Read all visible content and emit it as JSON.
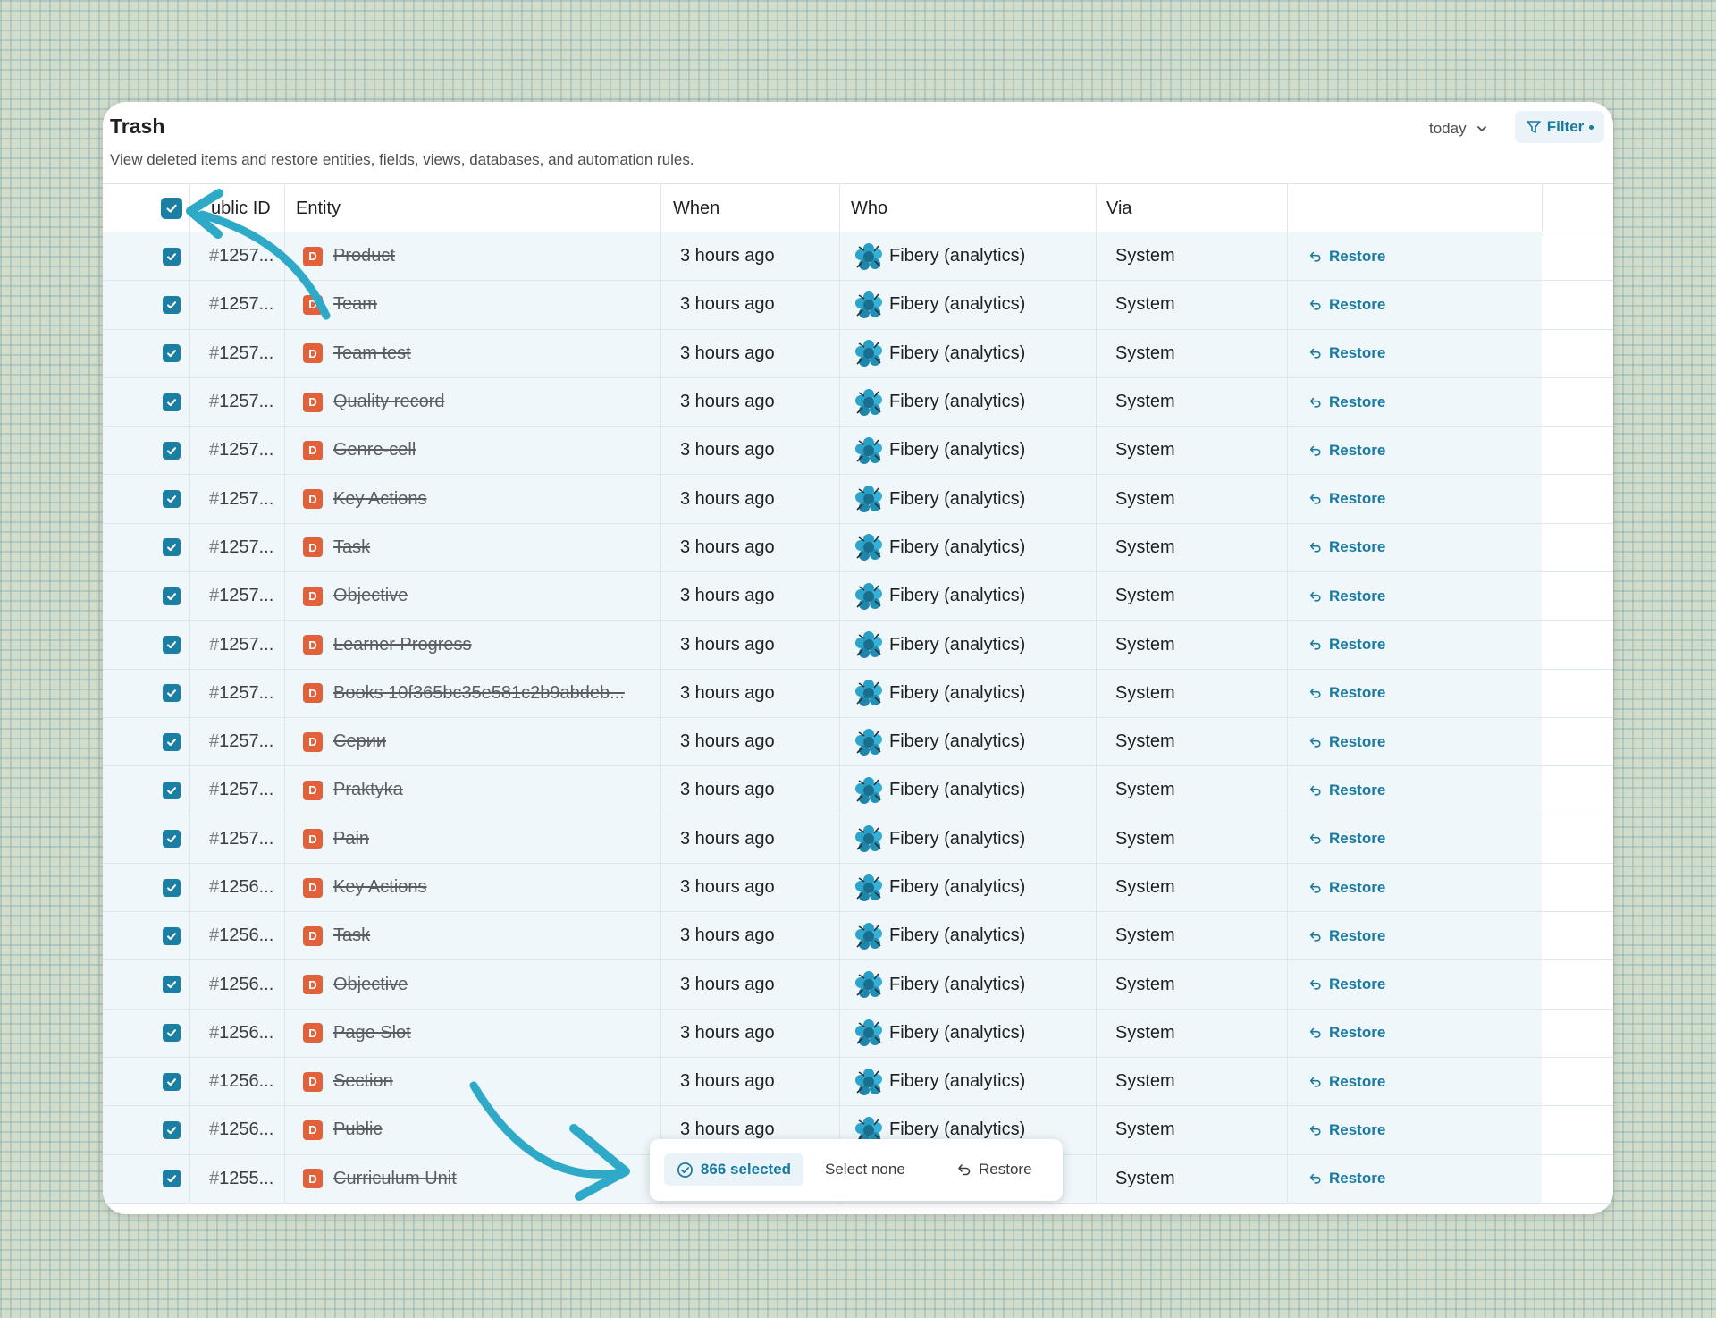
{
  "header": {
    "title": "Trash",
    "subtitle": "View deleted items and restore entities, fields, views, databases, and automation rules.",
    "date_filter": "today",
    "filter_label": "Filter"
  },
  "columns": {
    "public_id": "ublic ID",
    "entity": "Entity",
    "when": "When",
    "who": "Who",
    "via": "Via"
  },
  "rows": [
    {
      "pid": "1257...",
      "badge": "D",
      "entity": "Product",
      "when": "3 hours ago",
      "who": "Fibery (analytics)",
      "via": "System",
      "action": "Restore"
    },
    {
      "pid": "1257...",
      "badge": "D",
      "entity": "Team",
      "when": "3 hours ago",
      "who": "Fibery (analytics)",
      "via": "System",
      "action": "Restore"
    },
    {
      "pid": "1257...",
      "badge": "D",
      "entity": "Team test",
      "when": "3 hours ago",
      "who": "Fibery (analytics)",
      "via": "System",
      "action": "Restore"
    },
    {
      "pid": "1257...",
      "badge": "D",
      "entity": "Quality record",
      "when": "3 hours ago",
      "who": "Fibery (analytics)",
      "via": "System",
      "action": "Restore"
    },
    {
      "pid": "1257...",
      "badge": "D",
      "entity": "Genre-cell",
      "when": "3 hours ago",
      "who": "Fibery (analytics)",
      "via": "System",
      "action": "Restore"
    },
    {
      "pid": "1257...",
      "badge": "D",
      "entity": "Key Actions",
      "when": "3 hours ago",
      "who": "Fibery (analytics)",
      "via": "System",
      "action": "Restore"
    },
    {
      "pid": "1257...",
      "badge": "D",
      "entity": "Task",
      "when": "3 hours ago",
      "who": "Fibery (analytics)",
      "via": "System",
      "action": "Restore"
    },
    {
      "pid": "1257...",
      "badge": "D",
      "entity": "Objective",
      "when": "3 hours ago",
      "who": "Fibery (analytics)",
      "via": "System",
      "action": "Restore"
    },
    {
      "pid": "1257...",
      "badge": "D",
      "entity": "Learner Progress",
      "when": "3 hours ago",
      "who": "Fibery (analytics)",
      "via": "System",
      "action": "Restore"
    },
    {
      "pid": "1257...",
      "badge": "D",
      "entity": "Books 10f365bc35e581c2b9abdeb...",
      "when": "3 hours ago",
      "who": "Fibery (analytics)",
      "via": "System",
      "action": "Restore"
    },
    {
      "pid": "1257...",
      "badge": "D",
      "entity": "Серии",
      "when": "3 hours ago",
      "who": "Fibery (analytics)",
      "via": "System",
      "action": "Restore"
    },
    {
      "pid": "1257...",
      "badge": "D",
      "entity": "Praktyka",
      "when": "3 hours ago",
      "who": "Fibery (analytics)",
      "via": "System",
      "action": "Restore"
    },
    {
      "pid": "1257...",
      "badge": "D",
      "entity": "Pain",
      "when": "3 hours ago",
      "who": "Fibery (analytics)",
      "via": "System",
      "action": "Restore"
    },
    {
      "pid": "1256...",
      "badge": "D",
      "entity": "Key Actions",
      "when": "3 hours ago",
      "who": "Fibery (analytics)",
      "via": "System",
      "action": "Restore"
    },
    {
      "pid": "1256...",
      "badge": "D",
      "entity": "Task",
      "when": "3 hours ago",
      "who": "Fibery (analytics)",
      "via": "System",
      "action": "Restore"
    },
    {
      "pid": "1256...",
      "badge": "D",
      "entity": "Objective",
      "when": "3 hours ago",
      "who": "Fibery (analytics)",
      "via": "System",
      "action": "Restore"
    },
    {
      "pid": "1256...",
      "badge": "D",
      "entity": "Page Slot",
      "when": "3 hours ago",
      "who": "Fibery (analytics)",
      "via": "System",
      "action": "Restore"
    },
    {
      "pid": "1256...",
      "badge": "D",
      "entity": "Section",
      "when": "3 hours ago",
      "who": "Fibery (analytics)",
      "via": "System",
      "action": "Restore"
    },
    {
      "pid": "1256...",
      "badge": "D",
      "entity": "Public",
      "when": "3 hours ago",
      "who": "Fibery (analytics)",
      "via": "System",
      "action": "Restore"
    },
    {
      "pid": "1255...",
      "badge": "D",
      "entity": "Curriculum Unit",
      "when": "",
      "who": "",
      "via": "System",
      "action": "Restore"
    }
  ],
  "selection_bar": {
    "count_label": "866 selected",
    "select_none": "Select none",
    "restore": "Restore"
  },
  "icons": {
    "check": "check-icon",
    "chevron": "chevron-down-icon",
    "filter": "filter-icon",
    "restore": "undo-arrow-icon",
    "who": "fibery-logo-icon"
  },
  "colors": {
    "accent": "#1a7aa0",
    "badge": "#e0613a",
    "row_bg": "#eff7fa",
    "arrow": "#2fa9c8"
  }
}
